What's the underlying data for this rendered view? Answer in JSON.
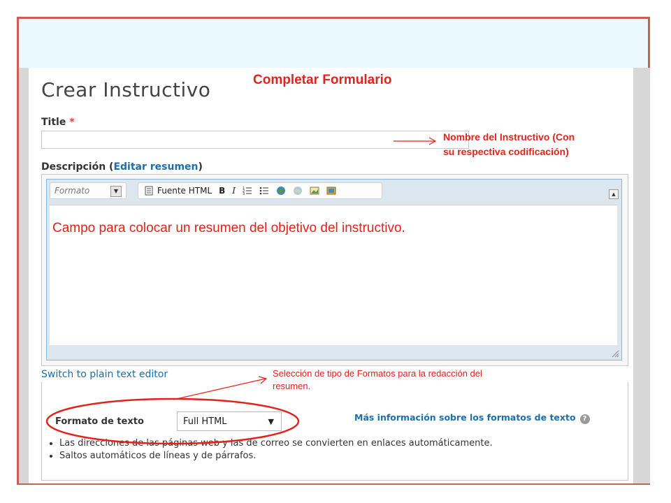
{
  "annotations": {
    "slide_title": "Completar Formulario",
    "title_note_line1": "Nombre del Instructivo (Con",
    "title_note_line2": "su respectiva codificación)",
    "editor_note": "Campo para colocar un resumen del objetivo del instructivo.",
    "format_note_line1": "Selección de tipo de Formatos para la redacción del",
    "format_note_line2": "resumen."
  },
  "page": {
    "heading": "Crear Instructivo"
  },
  "title_field": {
    "label": "Title",
    "required_mark": "*",
    "value": ""
  },
  "description": {
    "label_prefix": "Descripción (",
    "edit_summary_link": "Editar resumen",
    "label_suffix": ")"
  },
  "toolbar": {
    "format_placeholder": "Formato",
    "source_label": "Fuente HTML",
    "bold": "B",
    "italic": "I",
    "buttons": [
      "numbered-list",
      "bulleted-list",
      "link",
      "unlink",
      "image",
      "media"
    ]
  },
  "switch_editor_link": "Switch to plain text editor",
  "text_format": {
    "label": "Formato de texto",
    "selected": "Full HTML",
    "more_info_link": "Más información sobre los formatos de texto",
    "tips": [
      "Las direcciones de las páginas web y las de correo se convierten en enlaces automáticamente.",
      "Saltos automáticos de líneas y de párrafos."
    ]
  },
  "colors": {
    "annotation_red": "#e2231a",
    "frame": "#c8614f",
    "link_blue": "#1e6fa8"
  }
}
